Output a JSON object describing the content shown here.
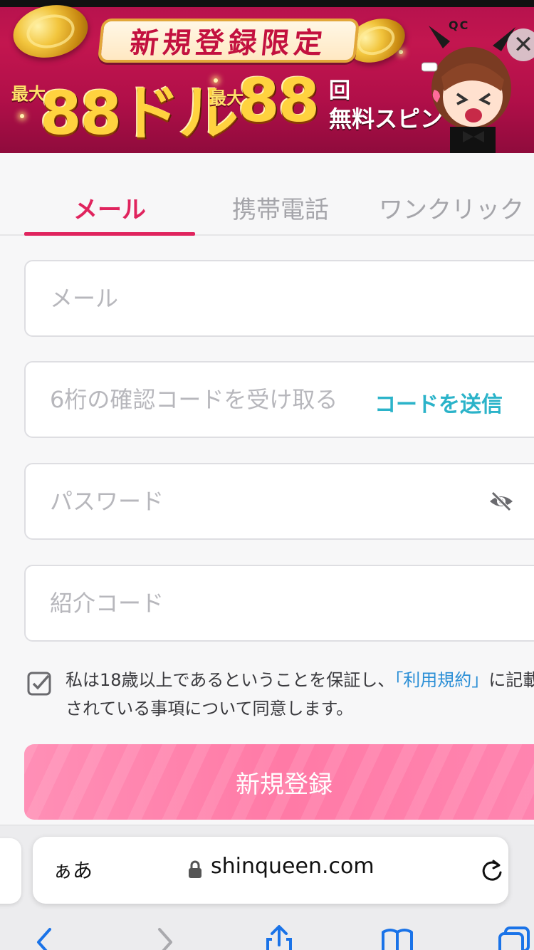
{
  "banner": {
    "ribbon_text": "新規登録限定",
    "max_label_1": "最大",
    "amount_1": "88ドル",
    "max_label_2": "最大",
    "amount_2": "88",
    "unit_2": "回",
    "spins_text": "無料スピン",
    "mascot_tag": "QC",
    "close_icon": "close-icon"
  },
  "tabs": [
    {
      "label": "メール",
      "active": true
    },
    {
      "label": "携帯電話",
      "active": false
    },
    {
      "label": "ワンクリック",
      "active": false
    }
  ],
  "form": {
    "email_placeholder": "メール",
    "code_placeholder": "6桁の確認コードを受け取る",
    "send_code_label": "コードを送信",
    "password_placeholder": "パスワード",
    "password_icon": "eye-slash-icon",
    "referral_placeholder": "紹介コード"
  },
  "agreement": {
    "checked": true,
    "text_before": "私は18歳以上であるということを保証し、",
    "link_text": "「利用規約」",
    "text_after": "に記載されている事項について同意します。"
  },
  "register_button": {
    "label": "新規登録"
  },
  "browser": {
    "aa_label": "ぁあ",
    "url": "shinqueen.com"
  },
  "colors": {
    "accent": "#e0245e",
    "link": "#2b8fd6",
    "send_code": "#2bb3c9",
    "button": "#ff85b0"
  }
}
